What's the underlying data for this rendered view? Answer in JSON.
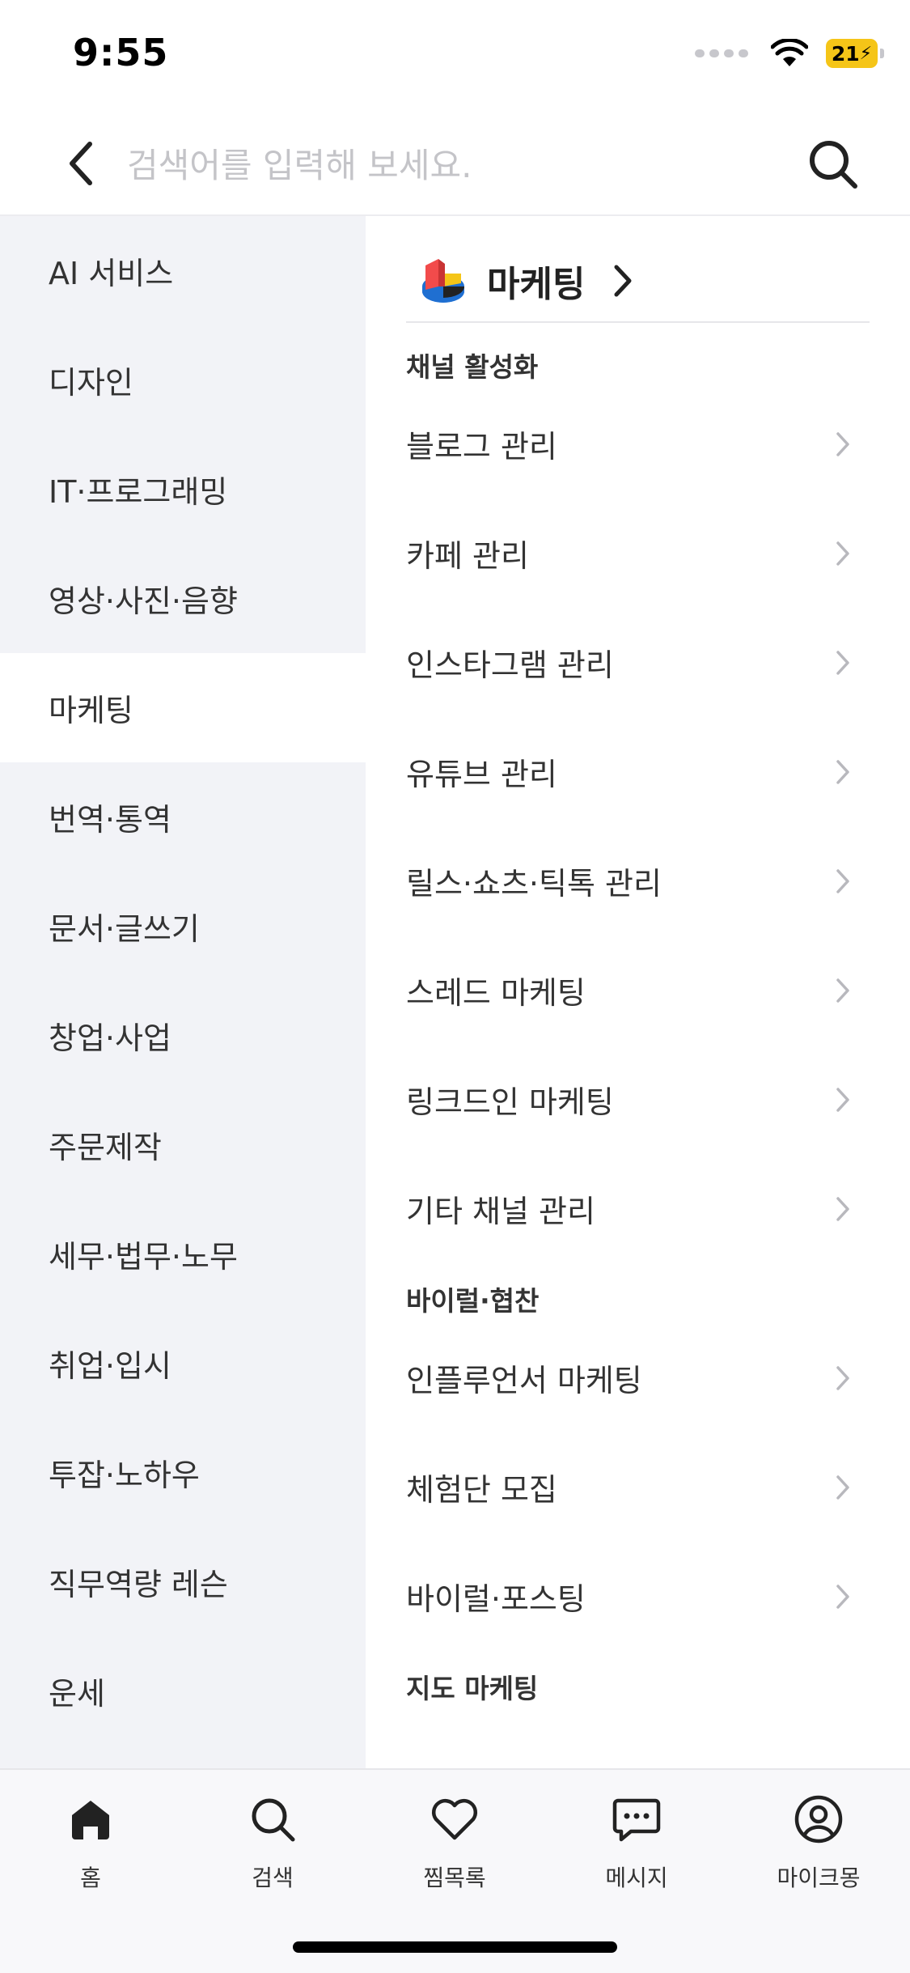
{
  "status_bar": {
    "time": "9:55",
    "battery": "21"
  },
  "header": {
    "search_placeholder": "검색어를 입력해 보세요."
  },
  "sidebar": {
    "items": [
      {
        "label": "AI 서비스"
      },
      {
        "label": "디자인"
      },
      {
        "label": "IT·프로그래밍"
      },
      {
        "label": "영상·사진·음향"
      },
      {
        "label": "마케팅",
        "active": true
      },
      {
        "label": "번역·통역"
      },
      {
        "label": "문서·글쓰기"
      },
      {
        "label": "창업·사업"
      },
      {
        "label": "주문제작"
      },
      {
        "label": "세무·법무·노무"
      },
      {
        "label": "취업·입시"
      },
      {
        "label": "투잡·노하우"
      },
      {
        "label": "직무역량 레슨"
      },
      {
        "label": "운세"
      }
    ]
  },
  "content": {
    "category_title": "마케팅",
    "sections": [
      {
        "title": "채널 활성화",
        "items": [
          "블로그 관리",
          "카페 관리",
          "인스타그램 관리",
          "유튜브 관리",
          "릴스·쇼츠·틱톡 관리",
          "스레드 마케팅",
          "링크드인 마케팅",
          "기타 채널 관리"
        ]
      },
      {
        "title": "바이럴·협찬",
        "items": [
          "인플루언서 마케팅",
          "체험단 모집",
          "바이럴·포스팅"
        ]
      },
      {
        "title": "지도 마케팅",
        "items": []
      }
    ]
  },
  "tabbar": {
    "home": "홈",
    "search": "검색",
    "wishlist": "찜목록",
    "messages": "메시지",
    "mypage": "마이크몽"
  },
  "colors": {
    "accent_battery": "#f5c518",
    "sidebar_bg": "#f2f3f7"
  }
}
